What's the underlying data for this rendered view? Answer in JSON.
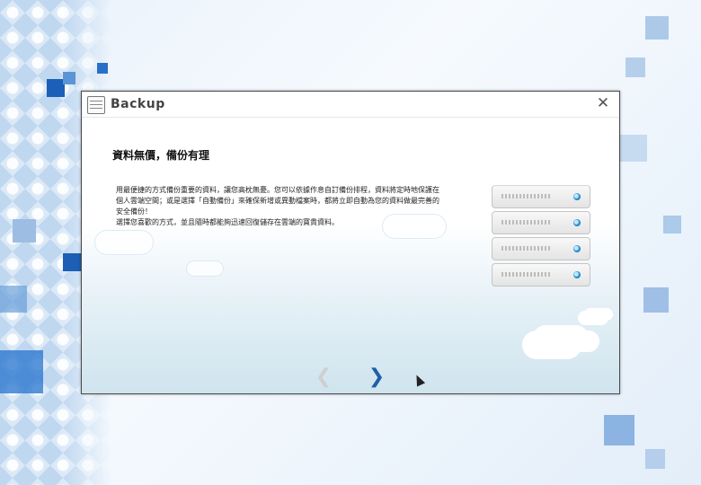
{
  "window": {
    "title": "Backup",
    "close_icon": "✕"
  },
  "content": {
    "heading": "資料無價，備份有理",
    "paragraphs": [
      "用最便捷的方式備份重要的資料，讓您高枕無憂。您可以依據作息自訂備份排程，資料將定時地保護在個人雲端空間；或是選擇「自動備份」來確保新增或異動檔案時，都將立即自動為您的資料做最完善的安全備份！",
      "選擇您喜歡的方式，並且隨時都能夠迅速回復儲存在雲端的寶貴資料。"
    ]
  },
  "nav": {
    "prev_icon": "❮",
    "next_icon": "❯"
  },
  "colors": {
    "accent": "#1f5fa8",
    "disabled": "#cfcfcf",
    "led": "#3aa2d8"
  },
  "icons": [
    "app-icon",
    "close-icon",
    "server-icon",
    "chevron-left-icon",
    "chevron-right-icon",
    "mouse-cursor-icon"
  ]
}
